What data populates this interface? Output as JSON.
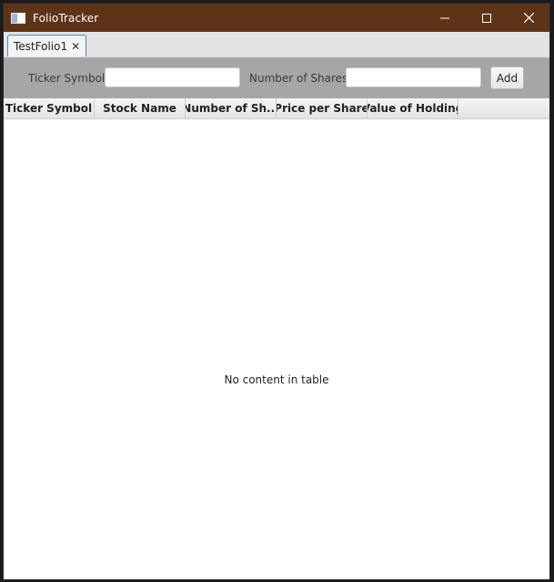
{
  "window": {
    "title": "FolioTracker",
    "controls": [
      "minimize",
      "maximize",
      "close"
    ]
  },
  "tabs": [
    {
      "label": "TestFolio1",
      "close_glyph": "✕",
      "selected": true
    }
  ],
  "toolbar": {
    "ticker_label": "Ticker Symbol",
    "ticker_value": "",
    "shares_label": "Number of Shares",
    "shares_value": "",
    "add_label": "Add"
  },
  "table": {
    "columns": [
      "Ticker Symbol",
      "Stock Name",
      "Number of Sh...",
      "Price per Share",
      "Value of Holding"
    ],
    "rows": [],
    "empty_message": "No content in table"
  },
  "colors": {
    "titlebar": "#5e3418",
    "toolbar": "#a6a6a6",
    "tab_accent": "#3a8fd1"
  }
}
